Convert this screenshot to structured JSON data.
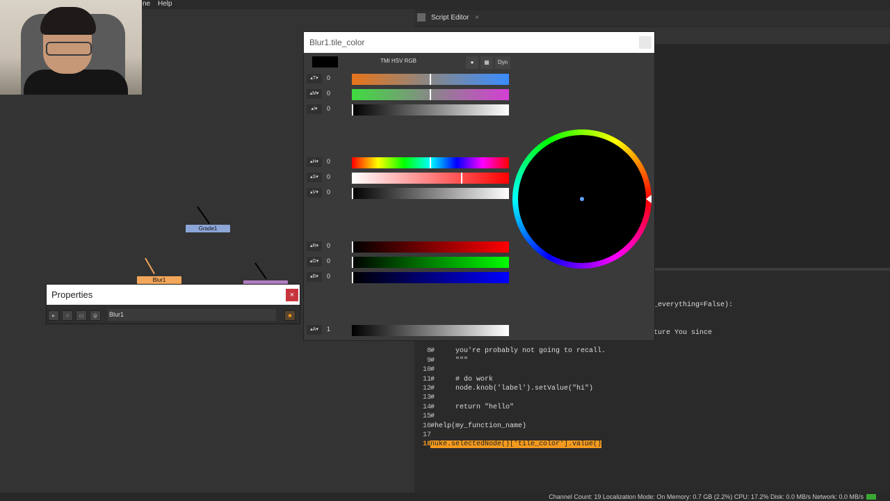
{
  "menubar": {
    "partial": "ne",
    "help": "Help"
  },
  "dag": {
    "nodes": {
      "grade": "Grade1",
      "blur": "Blur1"
    }
  },
  "properties": {
    "title": "Properties",
    "close": "×",
    "node_name": "Blur1"
  },
  "script_editor": {
    "tab": "Script Editor",
    "tab_close": "×",
    "output_lines": [
      "_everything=False):",
      "ture You since"
    ],
    "lines": [
      {
        "n": "8",
        "t": "#     you're probably not going to recall."
      },
      {
        "n": "9",
        "t": "#     \"\"\""
      },
      {
        "n": "10",
        "t": "#"
      },
      {
        "n": "11",
        "t": "#     # do work"
      },
      {
        "n": "12",
        "t": "#     node.knob('label').setValue(\"hi\")"
      },
      {
        "n": "13",
        "t": "#"
      },
      {
        "n": "14",
        "t": "#     return \"hello\""
      },
      {
        "n": "15",
        "t": "#"
      },
      {
        "n": "16",
        "t": "#help(my_function_name)"
      },
      {
        "n": "17",
        "t": ""
      },
      {
        "n": "18",
        "t": "nuke.selectedNode()['tile_color'].value()"
      }
    ]
  },
  "status": "Channel Count: 19  Localization Mode: On  Memory: 0.7 GB (2.2%)  CPU: 17.2%  Disk: 0.0 MB/s  Network: 0.0 MB/s",
  "picker": {
    "title": "Blur1.tile_color",
    "modes": "TMI HSV RGB",
    "dyn": "Dyn",
    "sliders": [
      {
        "label": "T",
        "value": "0"
      },
      {
        "label": "M",
        "value": "0"
      },
      {
        "label": "I",
        "value": "0"
      },
      {
        "label": "H",
        "value": "0"
      },
      {
        "label": "S",
        "value": "0"
      },
      {
        "label": "V",
        "value": "0"
      },
      {
        "label": "R",
        "value": "0"
      },
      {
        "label": "G",
        "value": "0"
      },
      {
        "label": "B",
        "value": "0"
      },
      {
        "label": "A",
        "value": "1"
      }
    ]
  },
  "colors": {
    "accent_highlight": "#f39a1e",
    "close_red": "#c8343c",
    "grade_node": "#8da6d8",
    "blur_node": "#f2a65a"
  }
}
